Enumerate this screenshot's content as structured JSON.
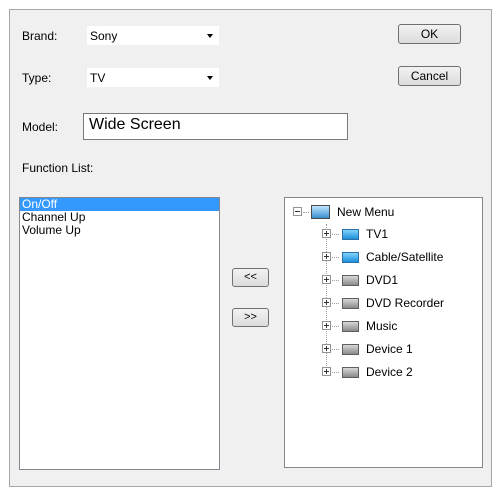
{
  "form": {
    "brand_label": "Brand:",
    "brand_value": "Sony",
    "type_label": "Type:",
    "type_value": "TV",
    "model_label": "Model:",
    "model_value": "Wide Screen",
    "function_list_label": "Function List:"
  },
  "buttons": {
    "ok": "OK",
    "cancel": "Cancel",
    "move_left": "<<",
    "move_right": ">>"
  },
  "function_list": {
    "items": [
      "On/Off",
      "Channel Up",
      "Volume Up"
    ],
    "selected_index": 0
  },
  "tree": {
    "root": {
      "label": "New Menu",
      "icon": "monitor-icon",
      "expanded": true
    },
    "children": [
      {
        "label": "TV1",
        "icon": "tv-icon",
        "color": "blue"
      },
      {
        "label": "Cable/Satellite",
        "icon": "cable-satellite-icon",
        "color": "blue"
      },
      {
        "label": "DVD1",
        "icon": "dvd-icon",
        "color": "gray"
      },
      {
        "label": "DVD Recorder",
        "icon": "dvd-recorder-icon",
        "color": "gray"
      },
      {
        "label": "Music",
        "icon": "music-icon",
        "color": "gray"
      },
      {
        "label": "Device 1",
        "icon": "device-icon",
        "color": "gray"
      },
      {
        "label": "Device 2",
        "icon": "device-icon",
        "color": "gray"
      }
    ]
  }
}
